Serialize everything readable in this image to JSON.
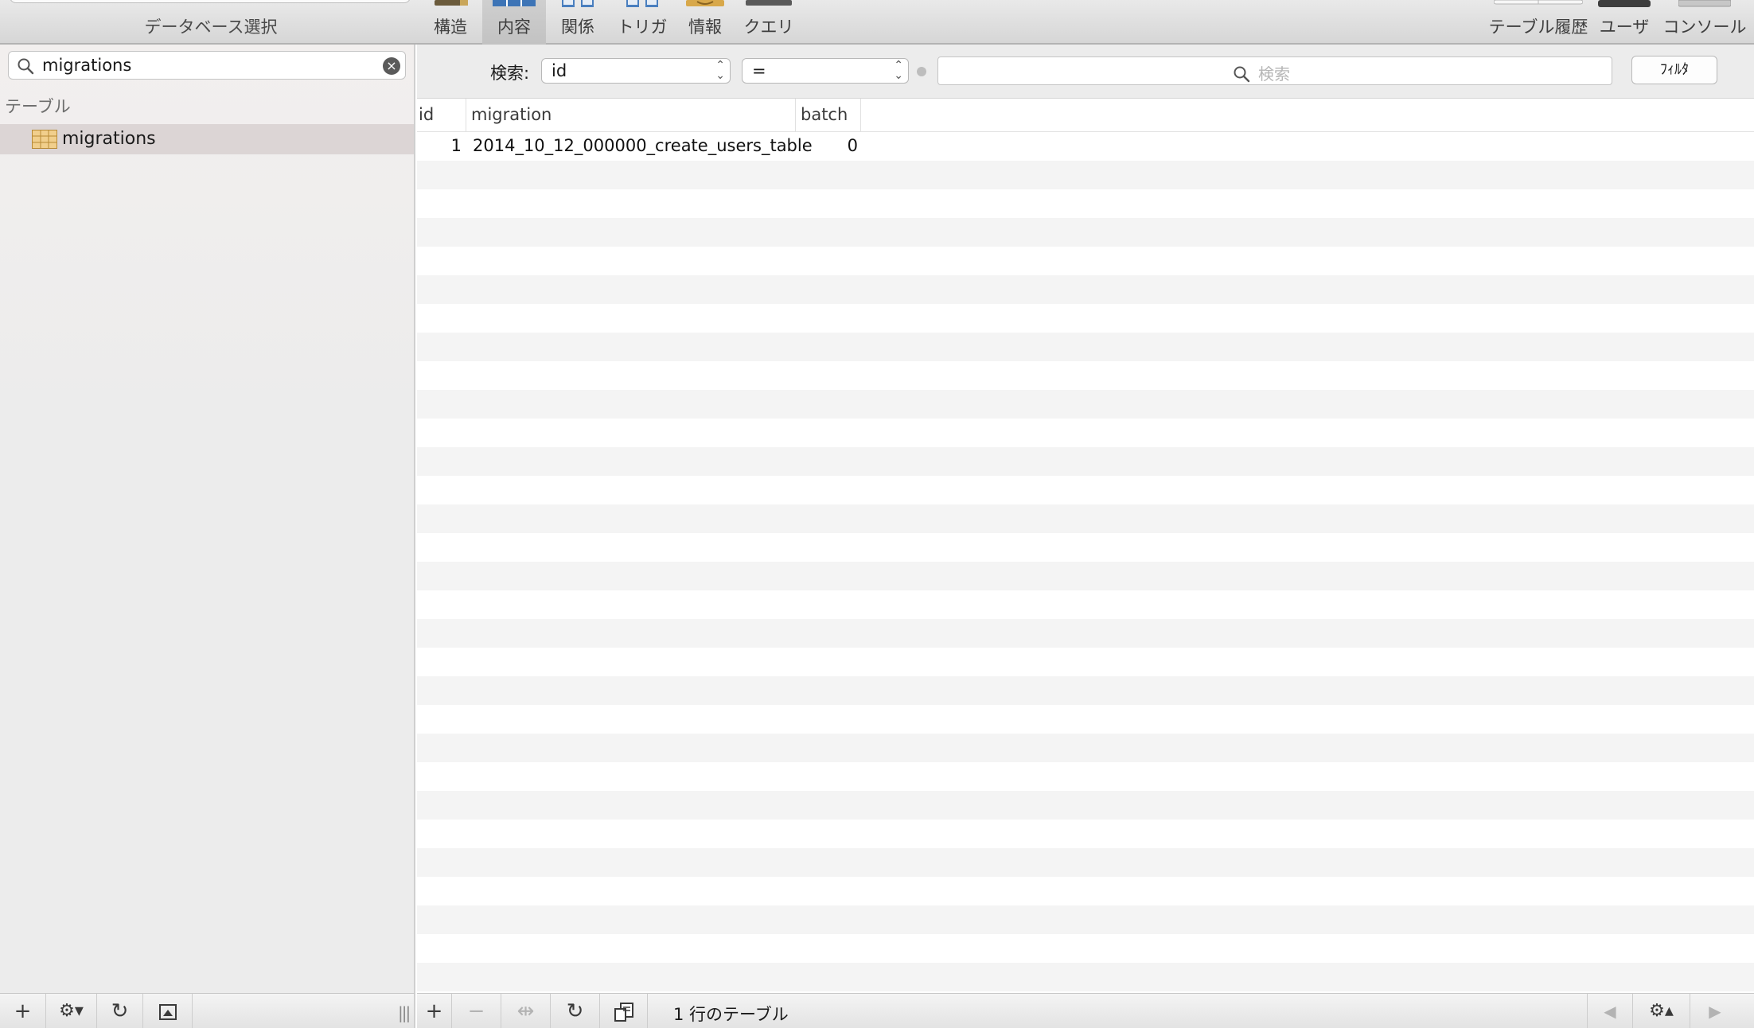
{
  "toolbar": {
    "database_label": "データベース選択",
    "buttons": [
      {
        "label": "構造",
        "icon": "structure-icon"
      },
      {
        "label": "内容",
        "icon": "content-icon",
        "active": true
      },
      {
        "label": "関係",
        "icon": "relations-icon"
      },
      {
        "label": "トリガ",
        "icon": "triggers-icon"
      },
      {
        "label": "情報",
        "icon": "info-icon"
      },
      {
        "label": "クエリ",
        "icon": "query-icon"
      }
    ],
    "right_buttons": [
      {
        "label": "テーブル履歴"
      },
      {
        "label": "ユーザ"
      },
      {
        "label": "コンソール"
      }
    ]
  },
  "sidebar": {
    "search_value": "migrations",
    "section_header": "テーブル",
    "tables": [
      {
        "name": "migrations"
      }
    ]
  },
  "filter": {
    "label": "検索:",
    "field": "id",
    "operator": "=",
    "placeholder": "検索",
    "button_label": "ﾌｨﾙﾀ"
  },
  "grid": {
    "columns": [
      "id",
      "migration",
      "batch"
    ],
    "rows": [
      {
        "id": "1",
        "migration": "2014_10_12_000000_create_users_table",
        "batch": "0"
      }
    ]
  },
  "status": {
    "text": "1 行のテーブル"
  },
  "colors": {
    "selection": "#dcd5d5",
    "accent": "#4a82c3",
    "table_icon": "#e8b865"
  }
}
